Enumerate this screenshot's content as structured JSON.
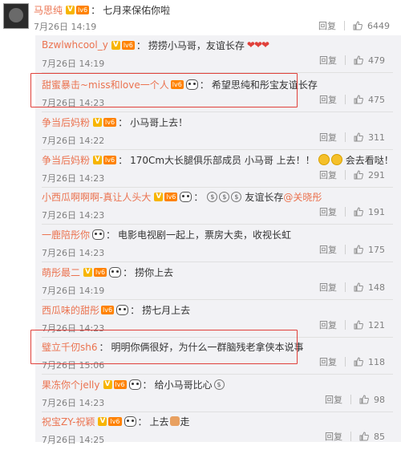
{
  "main_post": {
    "name": "马思纯",
    "text": "七月来保佑你啦",
    "time": "7月26日 14:19",
    "reply_label": "回复",
    "likes": "6449"
  },
  "replies": [
    {
      "name": "Bzwlwhcool_y",
      "vip": true,
      "level": "lv6",
      "panda": false,
      "text": "捞捞小马哥，友谊长存",
      "hearts": "❤❤❤",
      "time": "7月26日 14:19",
      "reply_label": "回复",
      "likes": "479"
    },
    {
      "name": "甜蜜暴击~miss和love一个人",
      "vip": false,
      "level": "lv6",
      "panda": true,
      "text": "希望思纯和彤宝友谊长存",
      "time": "7月26日 14:23",
      "reply_label": "回复",
      "likes": "475"
    },
    {
      "name": "争当后妈粉",
      "vip": true,
      "level": "lv6",
      "panda": false,
      "text": "小马哥上去！",
      "time": "7月26日 14:22",
      "reply_label": "回复",
      "likes": "311"
    },
    {
      "name": "争当后妈粉",
      "vip": true,
      "level": "lv6",
      "panda": false,
      "text": "170Cm大长腿俱乐部成员 小马哥 上去！！",
      "text_after": "会去看哒！",
      "time": "7月26日 14:23",
      "reply_label": "回复",
      "likes": "291"
    },
    {
      "name": "小西瓜啊啊啊-真让人头大",
      "vip": true,
      "level": "lv6",
      "panda": true,
      "text": "友谊长存",
      "mention": "@关晓彤",
      "time": "7月26日 14:23",
      "reply_label": "回复",
      "likes": "191"
    },
    {
      "name": "一鹿陪彤你",
      "vip": false,
      "level": "",
      "panda": true,
      "text": "电影电视剧一起上，票房大卖，收视长虹",
      "time": "7月26日 14:23",
      "reply_label": "回复",
      "likes": "175"
    },
    {
      "name": "萌彤最二",
      "vip": true,
      "level": "lv6",
      "panda": true,
      "text": "捞你上去",
      "time": "7月26日 14:19",
      "reply_label": "回复",
      "likes": "148"
    },
    {
      "name": "西瓜味的甜彤",
      "vip": false,
      "level": "lv6",
      "panda": true,
      "text": "捞七月上去",
      "time": "7月26日 14:23",
      "reply_label": "回复",
      "likes": "121"
    },
    {
      "name": "璧立千仞sh6",
      "vip": false,
      "level": "",
      "panda": false,
      "text": "明明你俩很好，为什么一群脑残老拿侠本说事",
      "time": "7月26日 15:06",
      "reply_label": "回复",
      "likes": "118"
    },
    {
      "name": "果冻你个jelly",
      "vip": true,
      "level": "lv6",
      "panda": true,
      "text": "给小马哥比心",
      "time": "7月26日 14:23",
      "reply_label": "回复",
      "likes": "98"
    },
    {
      "name": "祝宝ZY-祝颖",
      "vip": true,
      "level": "lv6",
      "panda": true,
      "text": "上去",
      "text_after": "走",
      "time": "7月26日 14:25",
      "reply_label": "回复",
      "likes": "85"
    }
  ],
  "colors": {
    "name": "#eb7350",
    "highlight": "#e0403a",
    "replies_bg": "#f2f2f5"
  },
  "icons": {
    "like": "thumb-up-icon",
    "vip": "v-badge-icon",
    "level": "level-badge-icon",
    "panda": "panda-icon"
  }
}
